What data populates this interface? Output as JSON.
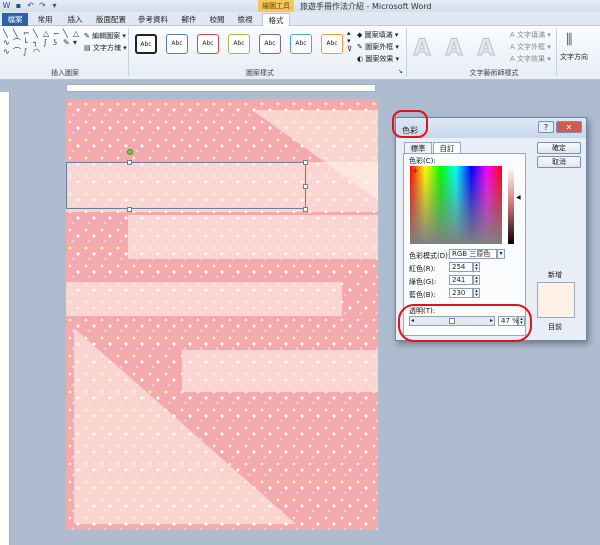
{
  "window": {
    "title": "旅遊手冊作法介紹 - Microsoft Word",
    "context_group": "繪圖工具"
  },
  "tabs": [
    "檔案",
    "常用",
    "插入",
    "版面配置",
    "參考資料",
    "郵件",
    "校閱",
    "檢視",
    "格式"
  ],
  "ribbon": {
    "insert_shapes": {
      "label": "插入圖案",
      "edit_shape": "編輯圖案",
      "text_box": "文字方塊"
    },
    "shape_styles": {
      "label": "圖案樣式",
      "style_label": "Abc",
      "fill": "圖案填滿",
      "outline": "圖案外框",
      "effects": "圖案效果",
      "swatch_colors": [
        "#222222",
        "#4f81bd",
        "#c0504d",
        "#9bbb59",
        "#8064a2",
        "#4bacc6",
        "#f79646"
      ]
    },
    "wordart_styles": {
      "label": "文字藝術師樣式",
      "letter": "A",
      "text_fill": "文字填滿",
      "text_outline": "文字外框",
      "text_effects": "文字效果"
    },
    "text": {
      "direction": "文字方向"
    }
  },
  "page": {
    "background_color": "#f4a9ad"
  },
  "dialog": {
    "title": "色彩",
    "help": "?",
    "close": "✕",
    "tabs": [
      "標準",
      "自訂"
    ],
    "colors_label": "色彩(C):",
    "model_label": "色彩模式(D):",
    "model_value": "RGB 三原色",
    "red_label": "紅色(R):",
    "red": "254",
    "green_label": "綠色(G):",
    "green": "241",
    "blue_label": "藍色(B):",
    "blue": "230",
    "transparency_label": "透明(T):",
    "transparency": "47 %",
    "transparency_fraction": 0.47,
    "ok": "確定",
    "cancel": "取消",
    "new_label": "新增",
    "current_label": "目前",
    "new_color": "#fef1e6"
  },
  "accent": {
    "highlight_oval": "#e0121a",
    "file_tab": "#2f5fa8"
  }
}
